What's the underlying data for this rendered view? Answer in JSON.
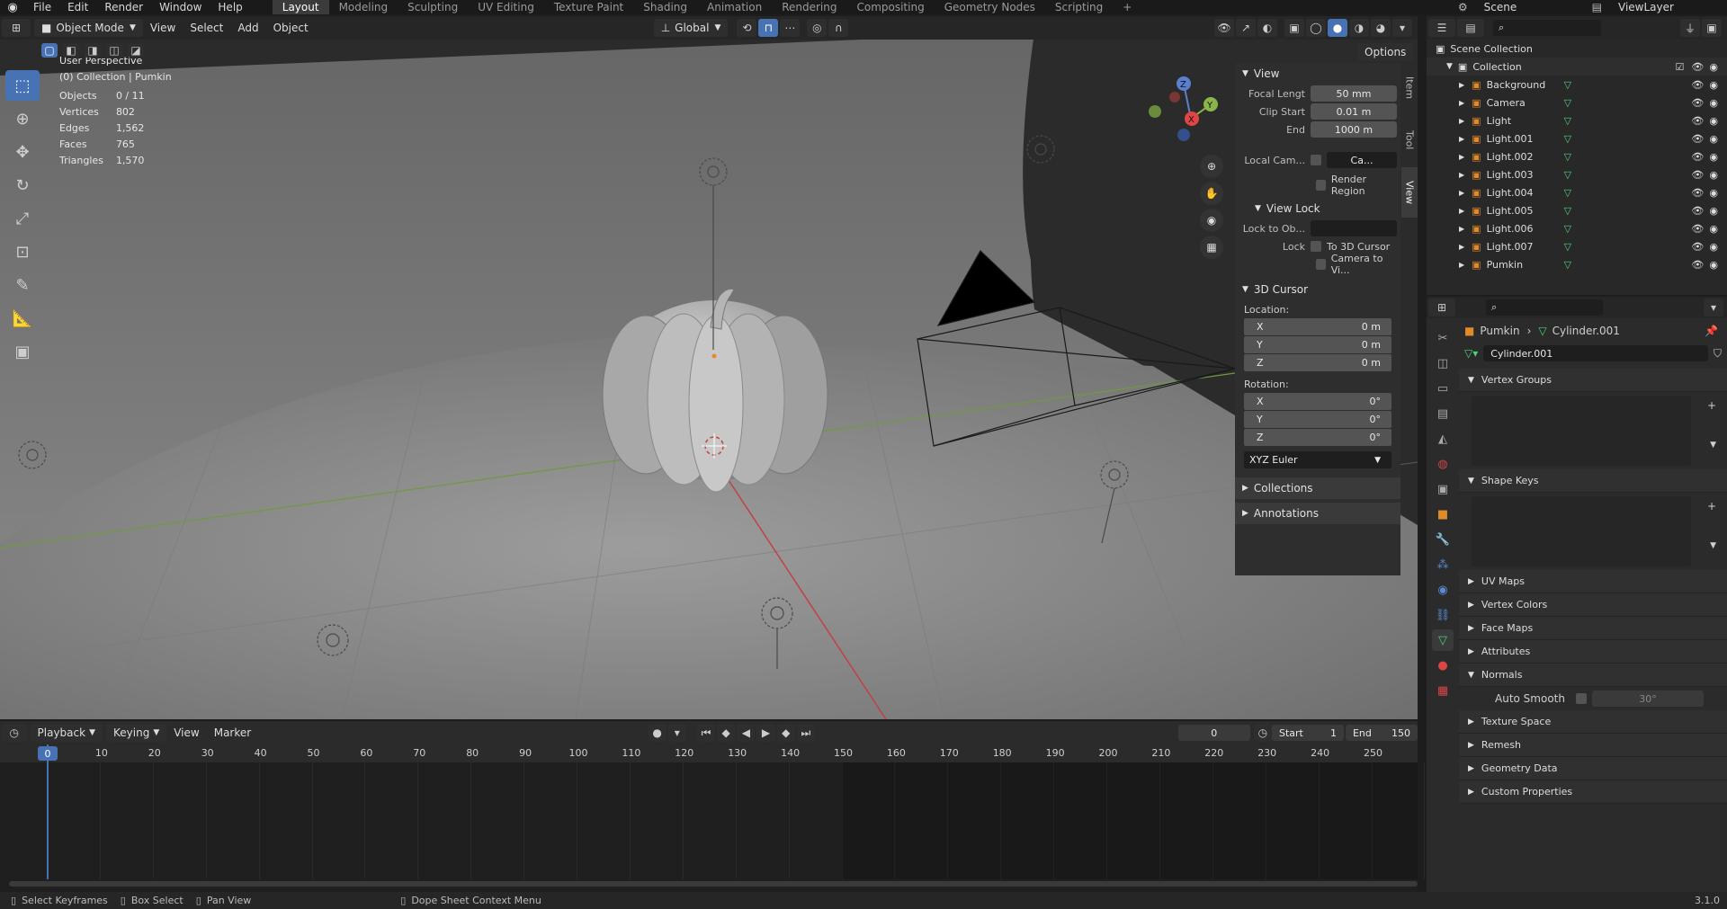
{
  "topbar": {
    "menus": [
      "File",
      "Edit",
      "Render",
      "Window",
      "Help"
    ],
    "workspaces": [
      "Layout",
      "Modeling",
      "Sculpting",
      "UV Editing",
      "Texture Paint",
      "Shading",
      "Animation",
      "Rendering",
      "Compositing",
      "Geometry Nodes",
      "Scripting"
    ],
    "active_workspace": "Layout",
    "add_label": "+",
    "scene_label": "Scene",
    "viewlayer_label": "ViewLayer"
  },
  "viewport_header": {
    "mode": "Object Mode",
    "menus": [
      "View",
      "Select",
      "Add",
      "Object"
    ],
    "transform_orientation": "Global",
    "options_label": "Options"
  },
  "overlay": {
    "perspective": "User Perspective",
    "collection_line": "(0) Collection | Pumkin",
    "stats": [
      {
        "label": "Objects",
        "value": "0 / 11"
      },
      {
        "label": "Vertices",
        "value": "802"
      },
      {
        "label": "Edges",
        "value": "1,562"
      },
      {
        "label": "Faces",
        "value": "765"
      },
      {
        "label": "Triangles",
        "value": "1,570"
      }
    ]
  },
  "npanel": {
    "tabs": [
      "Item",
      "Tool",
      "View"
    ],
    "active_tab": "View",
    "view_section": "View",
    "focal_label": "Focal Lengt",
    "focal_value": "50 mm",
    "clip_start_label": "Clip Start",
    "clip_start_value": "0.01 m",
    "end_label": "End",
    "end_value": "1000 m",
    "local_cam_label": "Local Cam...",
    "local_cam_value": "Ca...",
    "render_region_label": "Render Region",
    "view_lock_section": "View Lock",
    "lock_to_obj_label": "Lock to Ob...",
    "lock_label": "Lock",
    "to_3d_cursor_label": "To 3D Cursor",
    "camera_to_view_label": "Camera to Vi...",
    "cursor_section": "3D Cursor",
    "location_label": "Location:",
    "loc": [
      {
        "axis": "X",
        "value": "0 m"
      },
      {
        "axis": "Y",
        "value": "0 m"
      },
      {
        "axis": "Z",
        "value": "0 m"
      }
    ],
    "rotation_label": "Rotation:",
    "rot": [
      {
        "axis": "X",
        "value": "0°"
      },
      {
        "axis": "Y",
        "value": "0°"
      },
      {
        "axis": "Z",
        "value": "0°"
      }
    ],
    "rotation_mode": "XYZ Euler",
    "collections_section": "Collections",
    "annotations_section": "Annotations"
  },
  "gizmo": {
    "x": "X",
    "y": "Y",
    "z": "Z"
  },
  "timeline": {
    "menus": [
      "Playback",
      "Keying",
      "View",
      "Marker"
    ],
    "current_frame": "0",
    "start_label": "Start",
    "start_value": "1",
    "end_label": "End",
    "end_value": "150",
    "ruler_ticks": [
      "0",
      "10",
      "20",
      "30",
      "40",
      "50",
      "60",
      "70",
      "80",
      "90",
      "100",
      "110",
      "120",
      "130",
      "140",
      "150",
      "160",
      "170",
      "180",
      "190",
      "200",
      "210",
      "220",
      "230",
      "240",
      "250"
    ]
  },
  "statusbar": {
    "items": [
      "Select Keyframes",
      "Box Select",
      "Pan View",
      "Dope Sheet Context Menu"
    ],
    "version": "3.1.0"
  },
  "outliner": {
    "scene_collection": "Scene Collection",
    "collection": "Collection",
    "items": [
      "Background",
      "Camera",
      "Light",
      "Light.001",
      "Light.002",
      "Light.003",
      "Light.004",
      "Light.005",
      "Light.006",
      "Light.007",
      "Pumkin"
    ]
  },
  "properties": {
    "breadcrumb_object": "Pumkin",
    "breadcrumb_data": "Cylinder.001",
    "datablock_name": "Cylinder.001",
    "sections_open": [
      "Vertex Groups",
      "Shape Keys"
    ],
    "sections": [
      "UV Maps",
      "Vertex Colors",
      "Face Maps",
      "Attributes"
    ],
    "normals_section": "Normals",
    "auto_smooth_label": "Auto Smooth",
    "auto_smooth_angle": "30°",
    "sections_after": [
      "Texture Space",
      "Remesh",
      "Geometry Data",
      "Custom Properties"
    ]
  }
}
